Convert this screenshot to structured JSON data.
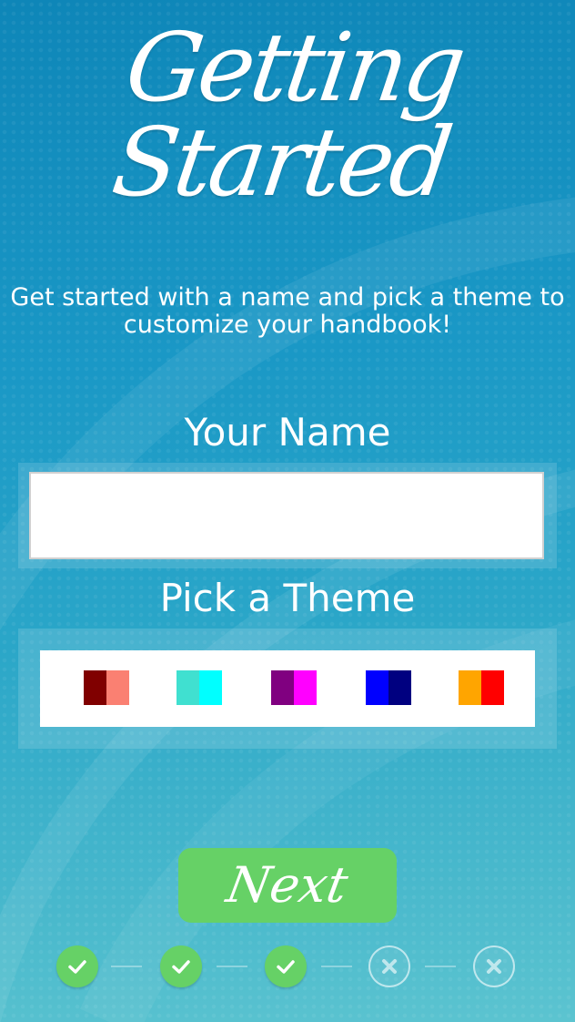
{
  "header": {
    "title": "Getting Started"
  },
  "intro": {
    "text_line1": "Get started with a name and pick a theme to",
    "text_line2": "customize your handbook!"
  },
  "name_section": {
    "label": "Your Name",
    "input_value": "",
    "input_placeholder": ""
  },
  "theme_section": {
    "label": "Pick a Theme",
    "themes": [
      {
        "name": "maroon-salmon-theme",
        "primary": "#800000",
        "secondary": "#fa8072"
      },
      {
        "name": "turquoise-cyan-theme",
        "primary": "#40e0d0",
        "secondary": "#00ffff"
      },
      {
        "name": "purple-magenta-theme",
        "primary": "#800080",
        "secondary": "#ff00ff"
      },
      {
        "name": "blue-navy-theme",
        "primary": "#0000ff",
        "secondary": "#000080"
      },
      {
        "name": "orange-red-theme",
        "primary": "#ffa500",
        "secondary": "#ff0000"
      }
    ]
  },
  "actions": {
    "next_label": "Next"
  },
  "progress": {
    "steps": [
      {
        "state": "complete",
        "icon": "check-icon"
      },
      {
        "state": "complete",
        "icon": "check-icon"
      },
      {
        "state": "complete",
        "icon": "check-icon"
      },
      {
        "state": "incomplete",
        "icon": "x-icon"
      },
      {
        "state": "incomplete",
        "icon": "x-icon"
      }
    ]
  },
  "colors": {
    "accent_green": "#66d166",
    "background_blue": "#1a98c6"
  }
}
